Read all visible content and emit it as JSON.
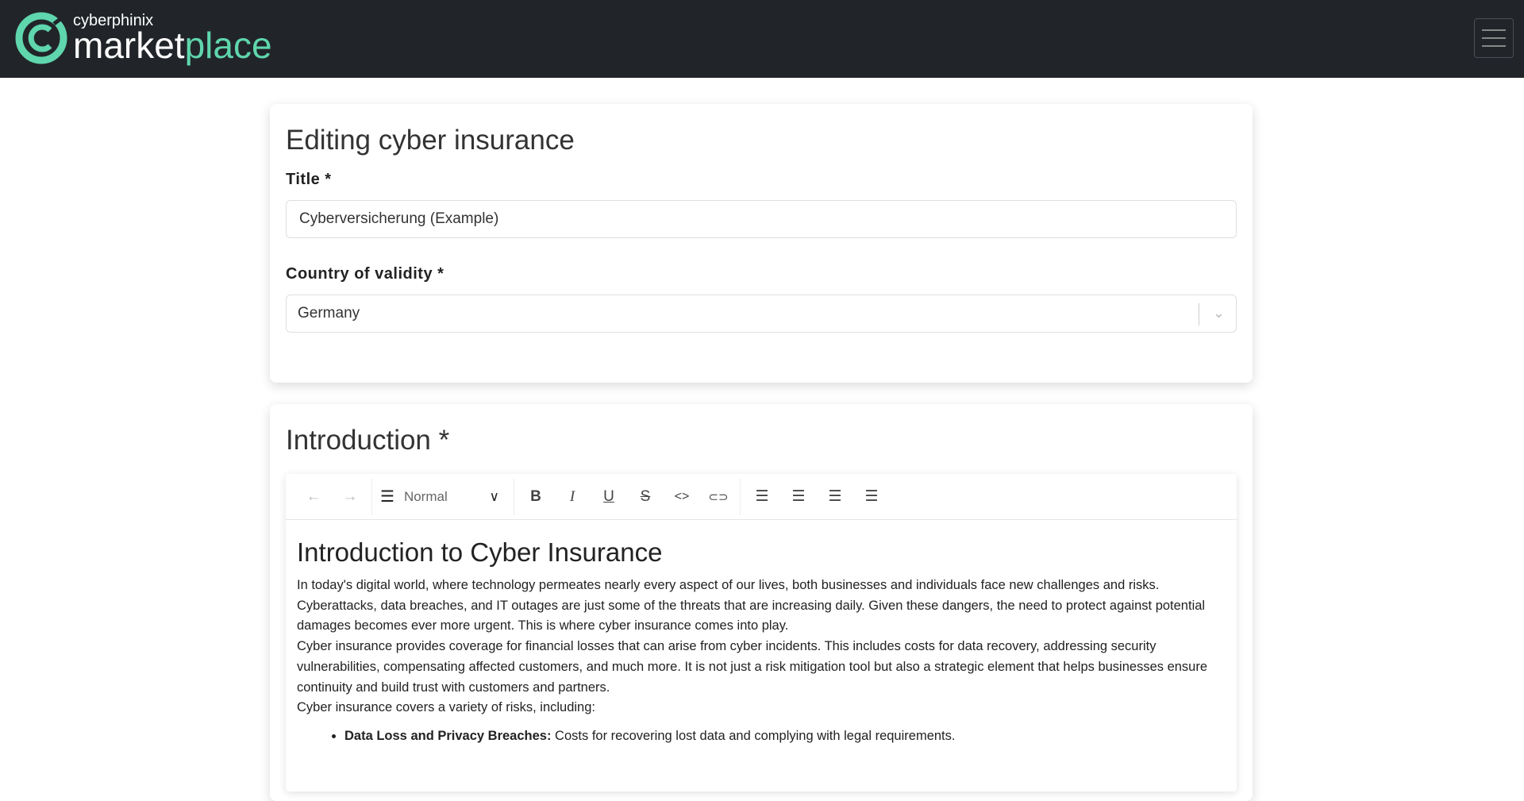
{
  "nav": {
    "brand_small": "cyberphinix",
    "brand_main": "market",
    "brand_accent": "place",
    "accent_color": "#5fd6ad",
    "menu_icon": "hamburger-icon"
  },
  "general": {
    "heading": "Editing cyber insurance",
    "title_label": "Title *",
    "title_value": "Cyberversicherung (Example)",
    "country_label": "Country of validity *",
    "country_value": "Germany"
  },
  "intro": {
    "heading": "Introduction *",
    "toolbar": {
      "undo": "←",
      "redo": "→",
      "format": "Normal",
      "bold": "B",
      "italic": "I",
      "underline": "U",
      "strike": "S",
      "code": "<>",
      "link": "⊂⊃"
    },
    "content": {
      "heading": "Introduction to Cyber Insurance",
      "paragraphs": [
        "In today's digital world, where technology permeates nearly every aspect of our lives, both businesses and individuals face new challenges and risks. Cyberattacks, data breaches, and IT outages are just some of the threats that are increasing daily. Given these dangers, the need to protect against potential damages becomes ever more urgent. This is where cyber insurance comes into play.",
        "Cyber insurance provides coverage for financial losses that can arise from cyber incidents. This includes costs for data recovery, addressing security vulnerabilities, compensating affected customers, and much more. It is not just a risk mitigation tool but also a strategic element that helps businesses ensure continuity and build trust with customers and partners.",
        "Cyber insurance covers a variety of risks, including:"
      ],
      "list": [
        {
          "term": "Data Loss and Privacy Breaches:",
          "text": " Costs for recovering lost data and complying with legal requirements."
        }
      ]
    }
  }
}
